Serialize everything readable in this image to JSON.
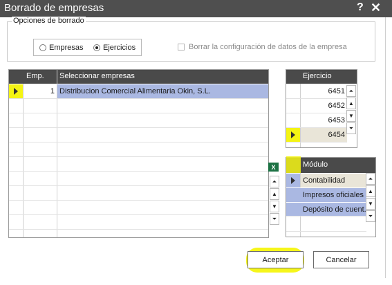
{
  "window": {
    "title": "Borrado de empresas",
    "help_label": "?",
    "close_label": "✕"
  },
  "options": {
    "legend": "Opciones de borrado",
    "radio_empresas": "Empresas",
    "radio_ejercicios": "Ejercicios",
    "selected_mode": "Ejercicios",
    "checkbox_label": "Borrar la configuración de datos de la  empresa",
    "checkbox_checked": false
  },
  "companies_grid": {
    "col_emp": "Emp.",
    "col_name": "Seleccionar empresas",
    "rows": [
      {
        "emp": "1",
        "name": "Distribucion Comercial Alimentaria Okin, S.L."
      }
    ]
  },
  "excel_icon": "excel-export-icon",
  "ejercicio_grid": {
    "header": "Ejercicio",
    "rows": [
      "6451",
      "6452",
      "6453",
      "6454"
    ]
  },
  "modulo_grid": {
    "header": "Módulo",
    "rows": [
      "Contabilidad",
      "Impresos oficiales",
      "Depósito de cuent..."
    ]
  },
  "nav_icons": {
    "first": "⏶",
    "prev": "▲",
    "next": "▼",
    "last": "⏷"
  },
  "buttons": {
    "accept": "Aceptar",
    "cancel": "Cancelar"
  },
  "highlight_color": "#f4f414",
  "selection_color": "#aab8e2"
}
